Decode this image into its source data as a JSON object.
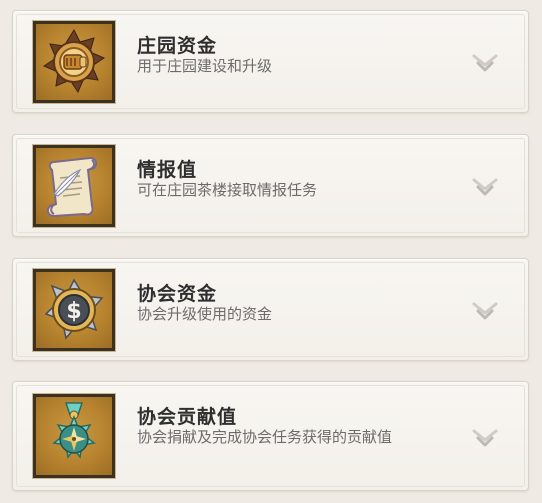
{
  "items": [
    {
      "title": "庄园资金",
      "description": "用于庄园建设和升级",
      "icon": "manor-fund-medallion-icon"
    },
    {
      "title": "情报值",
      "description": "可在庄园茶楼接取情报任务",
      "icon": "scroll-quill-icon"
    },
    {
      "title": "协会资金",
      "description": "协会升级使用的资金",
      "icon": "dollar-coin-icon"
    },
    {
      "title": "协会贡献值",
      "description": "协会捐献及完成协会任务获得的贡献值",
      "icon": "compass-medal-icon"
    }
  ],
  "colors": {
    "icon_background": "#b7832f",
    "card_background": "#f6f3ee",
    "title_text": "#2f2f2f",
    "description_text": "#6c6c6c",
    "chevron": "#c8c5c0"
  }
}
